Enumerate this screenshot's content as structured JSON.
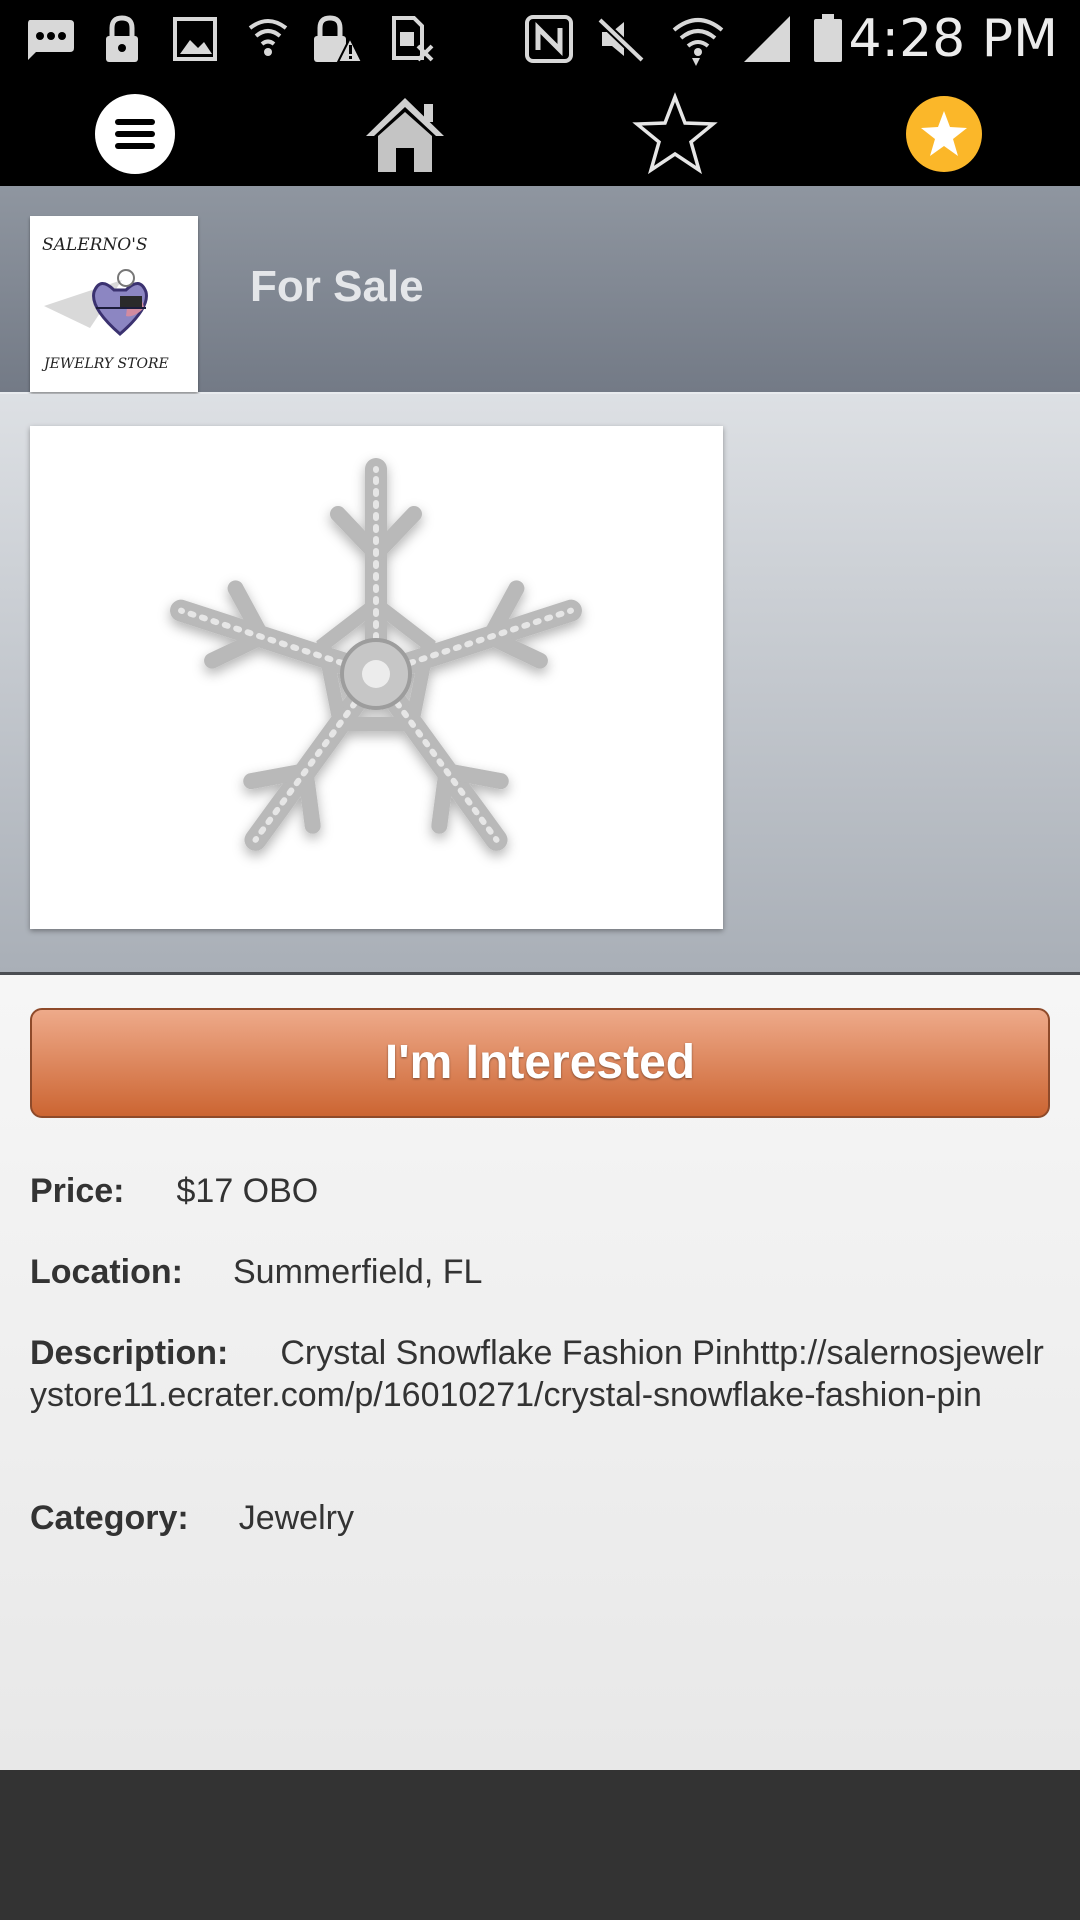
{
  "status_bar": {
    "time": "4:28 PM",
    "icons": [
      "message-icon",
      "lock-icon",
      "image-icon",
      "wifi-icon",
      "lock-warning-icon",
      "sim-off-icon",
      "nfc-icon",
      "mute-icon",
      "wifi-signal-icon",
      "cell-signal-icon",
      "battery-icon"
    ]
  },
  "nav": {
    "items": [
      "menu-icon",
      "home-icon",
      "star-outline-icon",
      "favorite-star-icon"
    ],
    "accent_color": "#fbb729"
  },
  "header": {
    "title": "For Sale",
    "logo_text_top": "SALERNO'S",
    "logo_text_bottom": "JEWELRY STORE"
  },
  "listing": {
    "cta_label": "I'm Interested",
    "price_label": "Price:",
    "price": "$17 OBO",
    "location_label": "Location:",
    "location": "Summerfield, FL",
    "description_label": "Description:",
    "description": "Crystal Snowflake Fashion Pinhttp://salernosjewelrystore11.ecrater.com/p/16010271/crystal-snowflake-fashion-pin",
    "category_label": "Category:",
    "category": "Jewelry"
  },
  "colors": {
    "cta_top": "#eeaa8a",
    "cta_bottom": "#cc6532",
    "header_top": "#8f96a0",
    "header_bottom": "#737a86"
  }
}
